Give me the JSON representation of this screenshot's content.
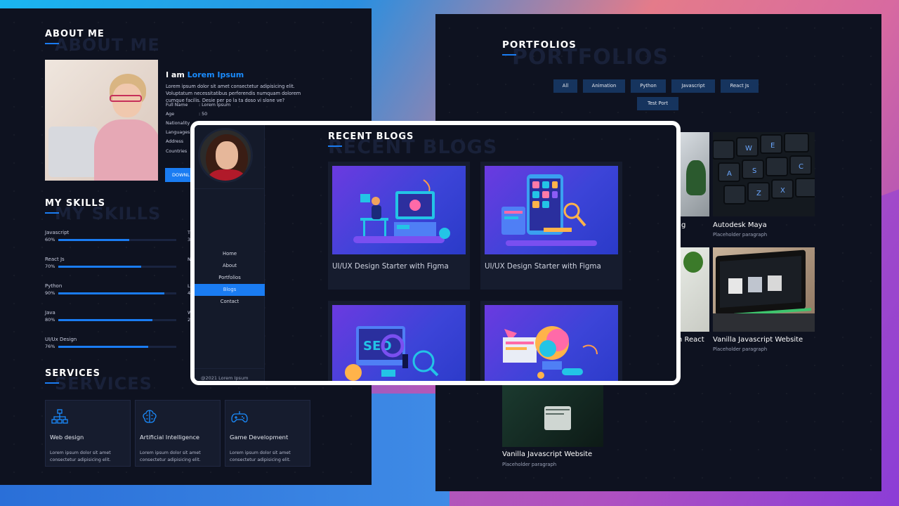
{
  "about": {
    "title": "ABOUT ME",
    "ghost": "ABOUT ME",
    "iam_prefix": "I am",
    "iam_name": "Lorem Ipsum",
    "description": "Lorem ipsum dolor sit amet consectetur adipisicing elit. Voluptatum necessitatibus perferendis numquam dolorem cumque facilis. Desie per po la ta doso vi slone ve?",
    "info": [
      {
        "label": "Full Name",
        "value": ": Lorem Ipsum"
      },
      {
        "label": "Age",
        "value": ": 50"
      },
      {
        "label": "Nationality",
        "value": ""
      },
      {
        "label": "Languages",
        "value": ""
      },
      {
        "label": "Address",
        "value": ""
      },
      {
        "label": "Countries",
        "value": ""
      }
    ],
    "download_label": "DOWNL"
  },
  "skills": {
    "title": "MY SKILLS",
    "ghost": "MY SKILLS",
    "items": [
      {
        "name": "Javascript",
        "pct": "60%",
        "level": 0.6
      },
      {
        "name": "React Js",
        "pct": "70%",
        "level": 0.7
      },
      {
        "name": "Python",
        "pct": "90%",
        "level": 0.9
      },
      {
        "name": "Java",
        "pct": "80%",
        "level": 0.8
      },
      {
        "name": "UI/Ux Design",
        "pct": "76%",
        "level": 0.76
      }
    ],
    "cut_letters": [
      "T",
      "3",
      "N",
      "L",
      "4",
      "W",
      "2"
    ]
  },
  "services": {
    "title": "SERVICES",
    "ghost": "SERVICES",
    "items": [
      {
        "name": "Web design",
        "desc": "Lorem ipsum dolor sit amet consectetur adipisicing elit.",
        "icon": "sitemap-icon"
      },
      {
        "name": "Artificial Intelligence",
        "desc": "Lorem ipsum dolor sit amet consectetur adipisicing elit.",
        "icon": "brain-icon"
      },
      {
        "name": "Game Development",
        "desc": "Lorem ipsum dolor sit amet consectetur adipisicing elit.",
        "icon": "gamepad-icon"
      }
    ]
  },
  "portfolios": {
    "title": "PORTFOLIOS",
    "ghost": "PORTFOLIOS",
    "filters": [
      "All",
      "Animation",
      "Python",
      "Javascript",
      "React Js",
      "Test Port"
    ],
    "items": [
      {
        "title": "g",
        "subtitle": ""
      },
      {
        "title": "Autodesk Maya",
        "subtitle": "Placeholder paragraph"
      },
      {
        "title": "h React",
        "subtitle": ""
      },
      {
        "title": "Vanilla Javascript Website",
        "subtitle": "Placeholder paragraph"
      },
      {
        "title": "Vanilla Javascript Website",
        "subtitle": "Placeholder paragraph"
      }
    ]
  },
  "blogs_window": {
    "nav": [
      "Home",
      "About",
      "Portfolios",
      "Blogs",
      "Contact"
    ],
    "active_nav": "Blogs",
    "copyright": "@2021 Lorem Ipsum",
    "title": "RECENT BLOGS",
    "ghost": "RECENT BLOGS",
    "posts": [
      {
        "title": "UI/UX Design Starter with Figma"
      },
      {
        "title": "UI/UX Design Starter with Figma"
      },
      {
        "title": ""
      },
      {
        "title": ""
      }
    ]
  },
  "colors": {
    "accent": "#1a7cf2",
    "panel": "#0e1220",
    "card": "#161c2e"
  }
}
